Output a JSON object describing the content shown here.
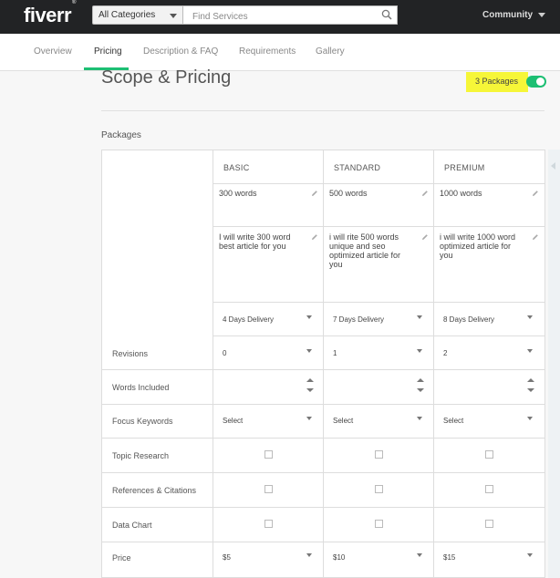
{
  "header": {
    "logo": "fiverr",
    "logo_mark": "®",
    "category_select": "All Categories",
    "search_placeholder": "Find Services",
    "community": "Community"
  },
  "tabs": [
    {
      "label": "Overview",
      "active": false
    },
    {
      "label": "Pricing",
      "active": true
    },
    {
      "label": "Description & FAQ",
      "active": false
    },
    {
      "label": "Requirements",
      "active": false
    },
    {
      "label": "Gallery",
      "active": false
    }
  ],
  "section": {
    "title": "Scope & Pricing",
    "packages_toggle_label": "3 Packages",
    "packages_toggle_on": true,
    "packages_label": "Packages"
  },
  "packages": {
    "headers": [
      "BASIC",
      "STANDARD",
      "PREMIUM"
    ],
    "names": [
      "300 words",
      "500 words",
      "1000 words"
    ],
    "descriptions": [
      "I will write 300 word best article for you",
      "i will rite 500 words unique and seo optimized article for you",
      "i will write 1000 word optimized article for you"
    ],
    "delivery": [
      "4 Days Delivery",
      "7 Days Delivery",
      "8 Days Delivery"
    ],
    "revisions": [
      "0",
      "1",
      "2"
    ],
    "words_included": [
      "",
      "",
      ""
    ],
    "focus_keywords": [
      "Select",
      "Select",
      "Select"
    ],
    "topic_research": [
      false,
      false,
      false
    ],
    "references_citations": [
      false,
      false,
      false
    ],
    "data_chart": [
      false,
      false,
      false
    ],
    "price": [
      "$5",
      "$10",
      "$15"
    ]
  },
  "row_labels": {
    "revisions": "Revisions",
    "words_included": "Words Included",
    "focus_keywords": "Focus Keywords",
    "topic_research": "Topic Research",
    "references_citations": "References & Citations",
    "data_chart": "Data Chart",
    "price": "Price"
  },
  "colors": {
    "topbar": "#222325",
    "accent_green": "#1dbf73",
    "highlight_yellow": "#f6f638"
  }
}
